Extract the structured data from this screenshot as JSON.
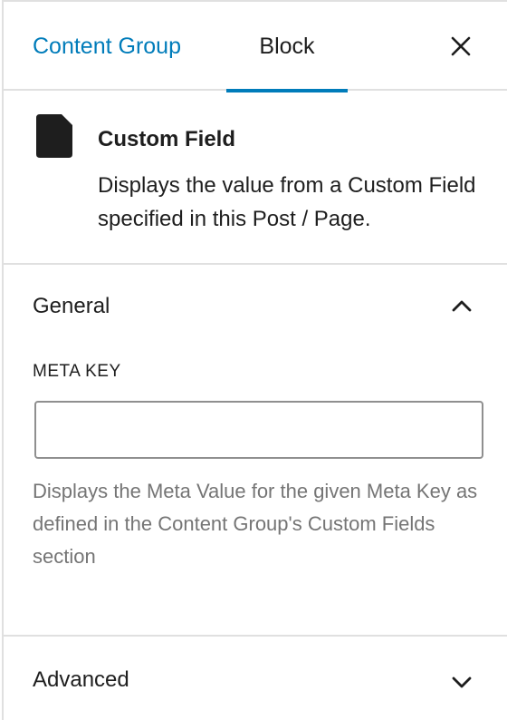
{
  "tabs": {
    "content_group": "Content Group",
    "block": "Block",
    "close_icon": "close-icon"
  },
  "block_card": {
    "icon": "document-icon",
    "title": "Custom Field",
    "description": "Displays the value from a Custom Field specified in this Post / Page."
  },
  "general": {
    "title": "General",
    "expanded": true,
    "chevron_icon": "chevron-up-icon",
    "meta_key": {
      "label": "META KEY",
      "value": "",
      "placeholder": ""
    },
    "help": "Displays the Meta Value for the given Meta Key as defined in the Content Group's Custom Fields section"
  },
  "advanced": {
    "title": "Advanced",
    "expanded": false,
    "chevron_icon": "chevron-down-icon"
  },
  "colors": {
    "accent": "#007cba",
    "text": "#1e1e1e",
    "muted": "#757575",
    "border": "#e0e0e0"
  }
}
